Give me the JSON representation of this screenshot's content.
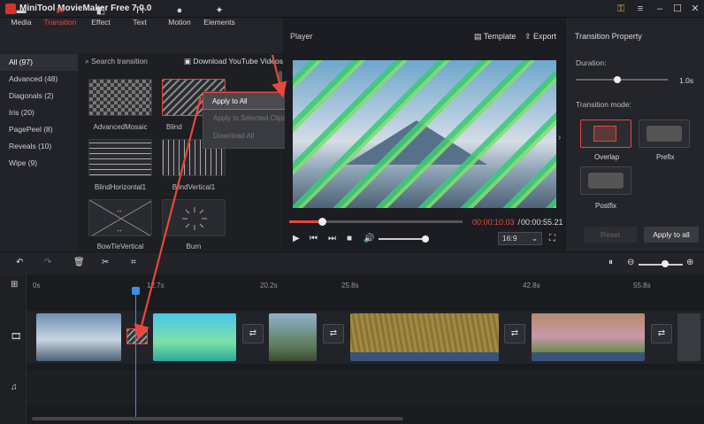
{
  "app": {
    "title": "MiniTool MovieMaker Free 7.0.0"
  },
  "toolbar": {
    "media": "Media",
    "transition": "Transition",
    "effect": "Effect",
    "text": "Text",
    "motion": "Motion",
    "elements": "Elements"
  },
  "categories": [
    {
      "label": "All (97)"
    },
    {
      "label": "Advanced (48)"
    },
    {
      "label": "Diagonals (2)"
    },
    {
      "label": "Iris (20)"
    },
    {
      "label": "PagePeel (8)"
    },
    {
      "label": "Reveals (10)"
    },
    {
      "label": "Wipe (9)"
    }
  ],
  "search": {
    "placeholder": "Search transition"
  },
  "download": {
    "label": "Download YouTube Videos"
  },
  "transitions": [
    {
      "name": "AdvancedMosaic"
    },
    {
      "name": "Blind"
    },
    {
      "name": "BlindHorizontal1"
    },
    {
      "name": "BlindVertical1"
    },
    {
      "name": "BowTieVertical"
    },
    {
      "name": "Burn"
    }
  ],
  "context_menu": {
    "apply_all": "Apply to All",
    "apply_selected": "Apply to Selected Clips",
    "download_all": "Download All"
  },
  "player": {
    "title": "Player",
    "template": "Template",
    "export": "Export",
    "current": "00:00:10.03",
    "separator": " / ",
    "total": "00:00:55.21",
    "aspect": "16:9",
    "progress": 0.19,
    "volume": 0.95
  },
  "property": {
    "title": "Transition Property",
    "duration_label": "Duration:",
    "duration_value": "1.0s",
    "duration_fraction": 0.45,
    "mode_label": "Transition mode:",
    "overlap": "Overlap",
    "prefix": "Prefix",
    "postfix": "Postfix",
    "reset": "Reset",
    "apply_all": "Apply to all"
  },
  "timeline": {
    "marks": [
      "0s",
      "12.7s",
      "20.2s",
      "25.8s",
      "42.8s",
      "55.8s"
    ],
    "zoom": 0.6
  },
  "colors": {
    "accent": "#e8473c",
    "highlight": "#e8473c"
  }
}
